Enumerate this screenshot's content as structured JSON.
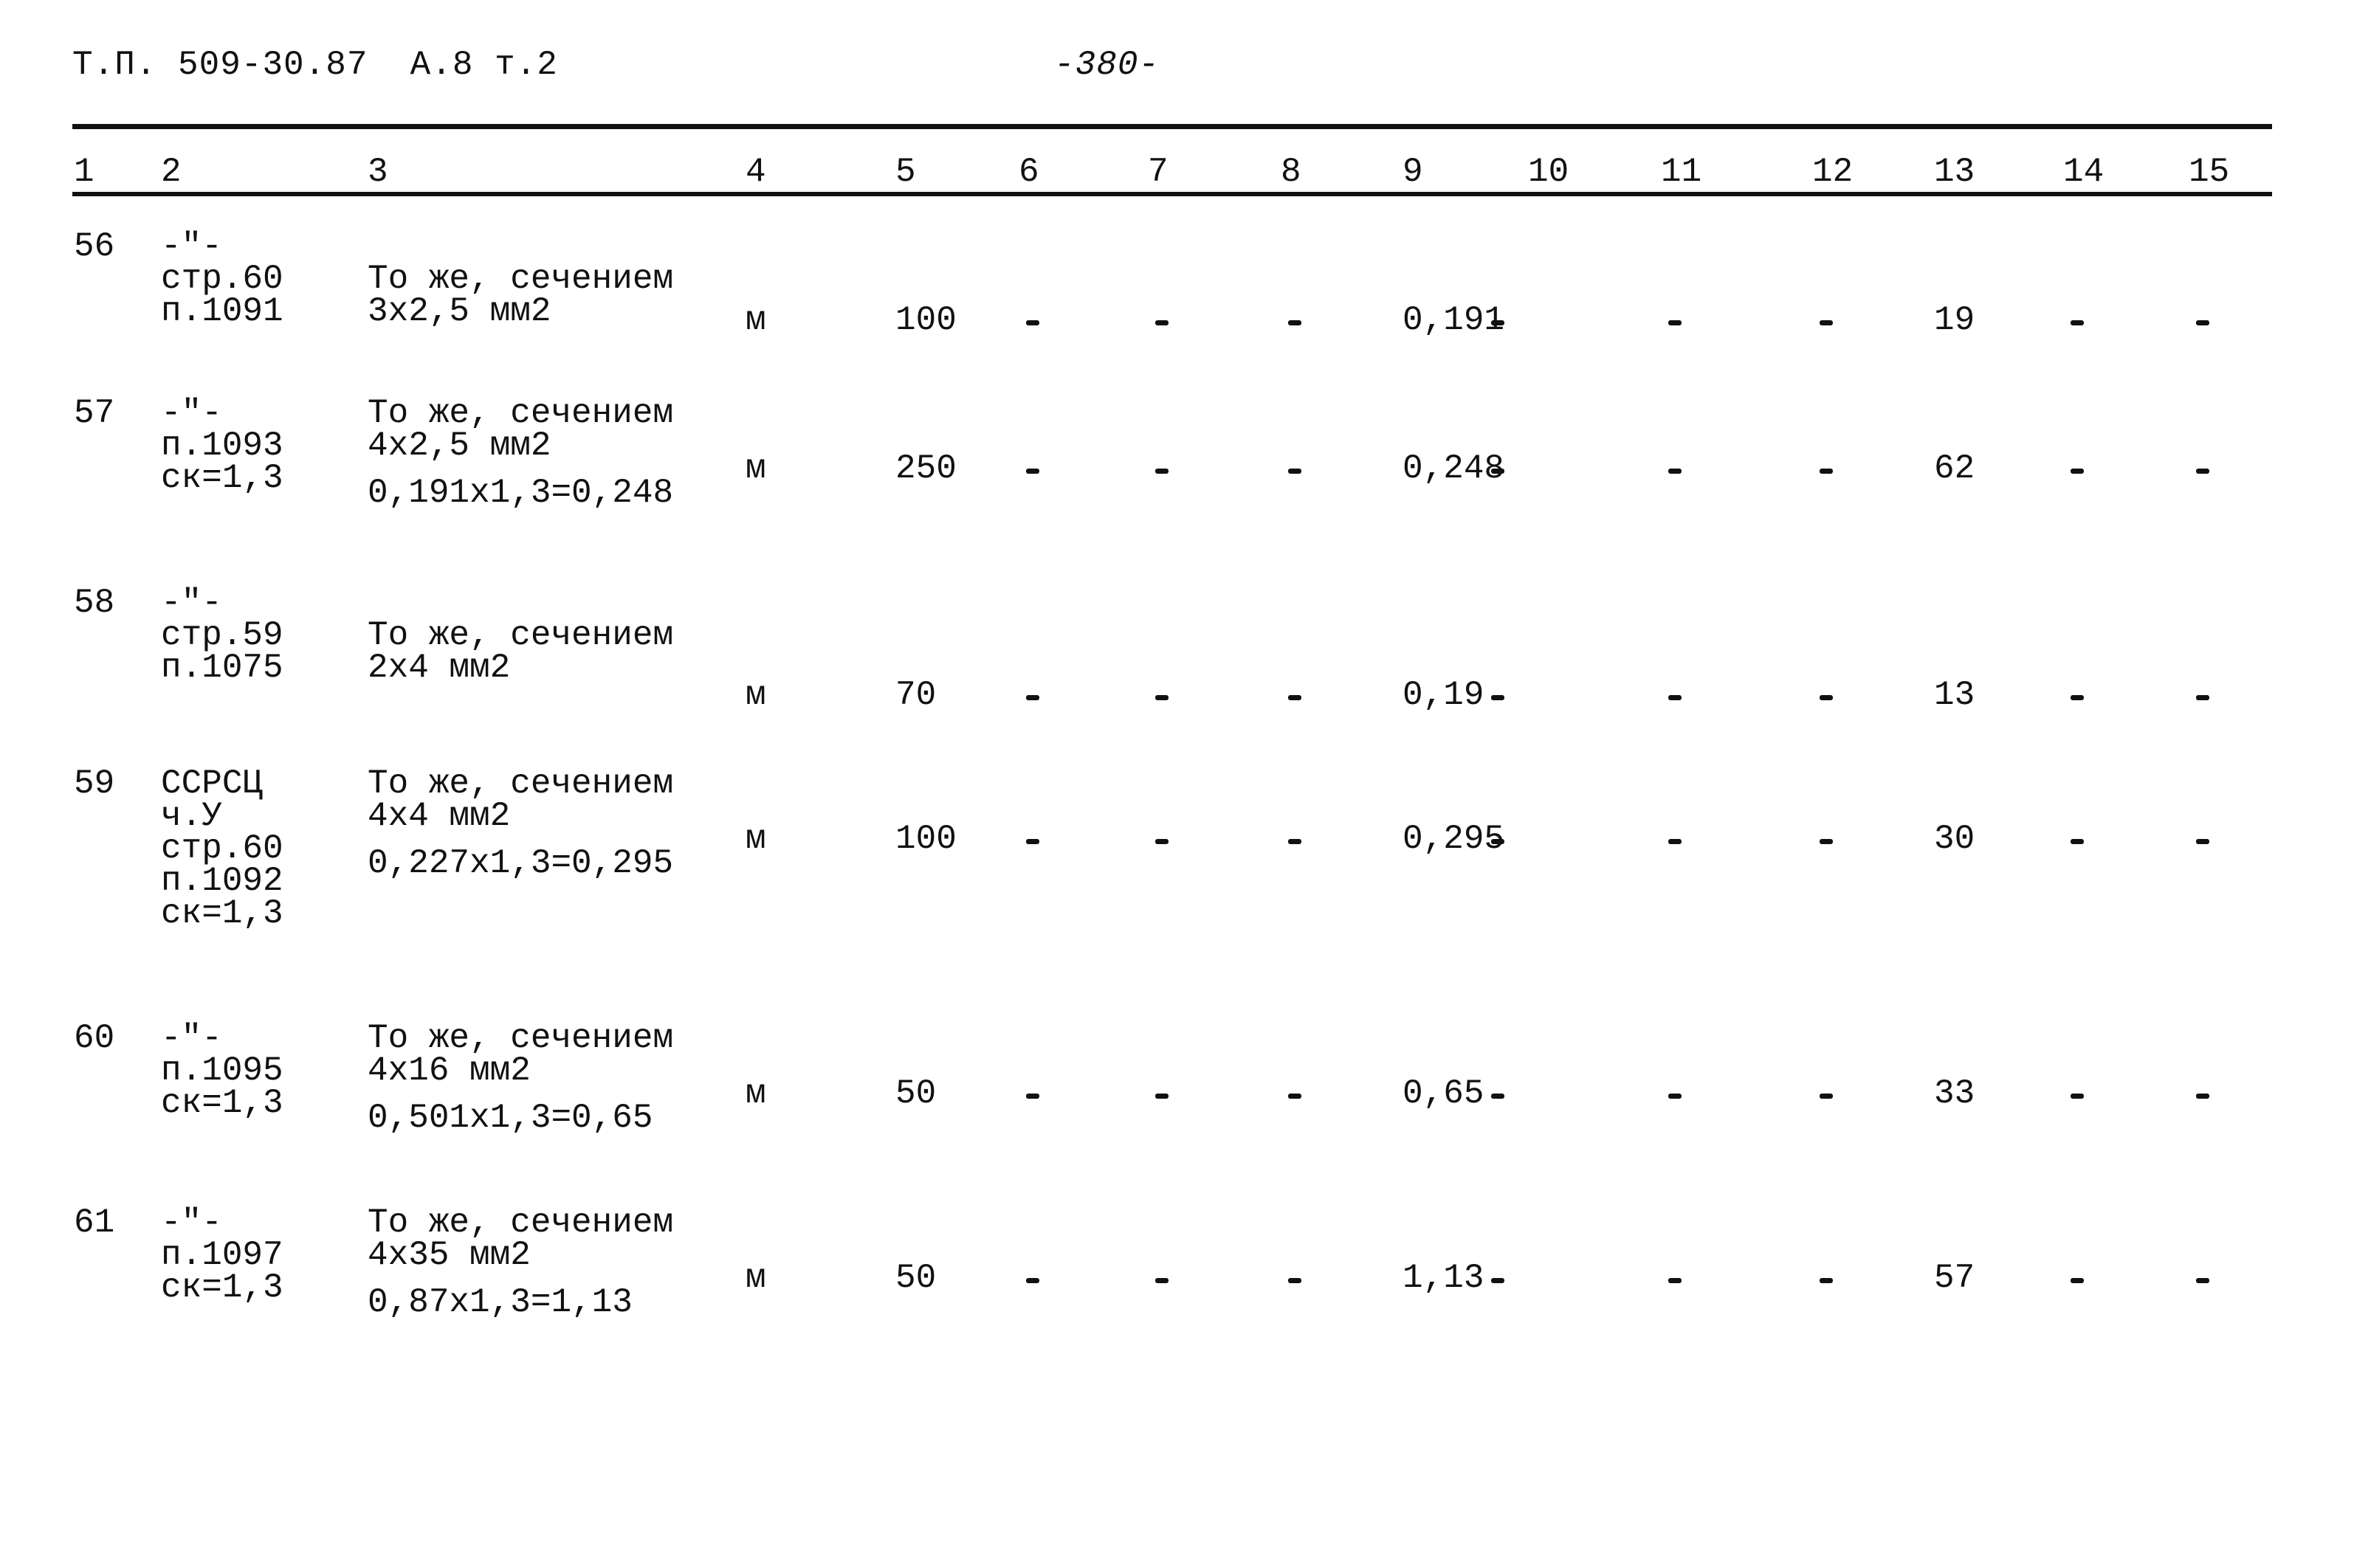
{
  "header": {
    "doc_code": "Т.П. 509-30.87  А.8 т.2",
    "page_number": "-380-"
  },
  "columns": [
    "1",
    "2",
    "3",
    "4",
    "5",
    "6",
    "7",
    "8",
    "9",
    "10",
    "11",
    "12",
    "13",
    "14",
    "15"
  ],
  "rows": [
    {
      "num": "56",
      "source": [
        "-\"-",
        "стр.60",
        "п.1091"
      ],
      "description": [
        "То же, сечением",
        "3х2,5 мм2"
      ],
      "calc": "",
      "unit": "м",
      "qty": "100",
      "c6": "-",
      "c7": "-",
      "c8": "-",
      "c9": "0,191",
      "c10": "-",
      "c11": "-",
      "c12": "-",
      "c13": "19",
      "c14": "-",
      "c15": "-"
    },
    {
      "num": "57",
      "source": [
        "-\"-",
        "п.1093",
        "ск=1,3"
      ],
      "description": [
        "То же, сечением",
        "4х2,5 мм2"
      ],
      "calc": "0,191х1,3=0,248",
      "unit": "м",
      "qty": "250",
      "c6": "-",
      "c7": "-",
      "c8": "-",
      "c9": "0,248",
      "c10": "-",
      "c11": "-",
      "c12": "-",
      "c13": "62",
      "c14": "-",
      "c15": "-"
    },
    {
      "num": "58",
      "source": [
        "-\"-",
        "стр.59",
        "п.1075"
      ],
      "description": [
        "То же, сечением",
        "2х4 мм2"
      ],
      "calc": "",
      "unit": "м",
      "qty": "70",
      "c6": "-",
      "c7": "-",
      "c8": "-",
      "c9": "0,19",
      "c10": "-",
      "c11": "-",
      "c12": "-",
      "c13": "13",
      "c14": "-",
      "c15": "-"
    },
    {
      "num": "59",
      "source": [
        "ССРСЦ",
        "ч.У",
        "стр.60",
        "п.1092",
        "ск=1,3"
      ],
      "description": [
        "То же, сечением",
        "4х4 мм2"
      ],
      "calc": "0,227х1,3=0,295",
      "unit": "м",
      "qty": "100",
      "c6": "-",
      "c7": "-",
      "c8": "-",
      "c9": "0,295",
      "c10": "-",
      "c11": "-",
      "c12": "-",
      "c13": "30",
      "c14": "-",
      "c15": "-"
    },
    {
      "num": "60",
      "source": [
        "-\"-",
        "п.1095",
        "ск=1,3"
      ],
      "description": [
        "То же, сечением",
        "4х16 мм2"
      ],
      "calc": "0,501х1,3=0,65",
      "unit": "м",
      "qty": "50",
      "c6": "-",
      "c7": "-",
      "c8": "-",
      "c9": "0,65",
      "c10": "-",
      "c11": "-",
      "c12": "-",
      "c13": "33",
      "c14": "-",
      "c15": "-"
    },
    {
      "num": "61",
      "source": [
        "-\"-",
        "п.1097",
        "ск=1,3"
      ],
      "description": [
        "То же, сечением",
        "4х35 мм2"
      ],
      "calc": "0,87х1,3=1,13",
      "unit": "м",
      "qty": "50",
      "c6": "-",
      "c7": "-",
      "c8": "-",
      "c9": "1,13",
      "c10": "-",
      "c11": "-",
      "c12": "-",
      "c13": "57",
      "c14": "-",
      "c15": "-"
    }
  ]
}
